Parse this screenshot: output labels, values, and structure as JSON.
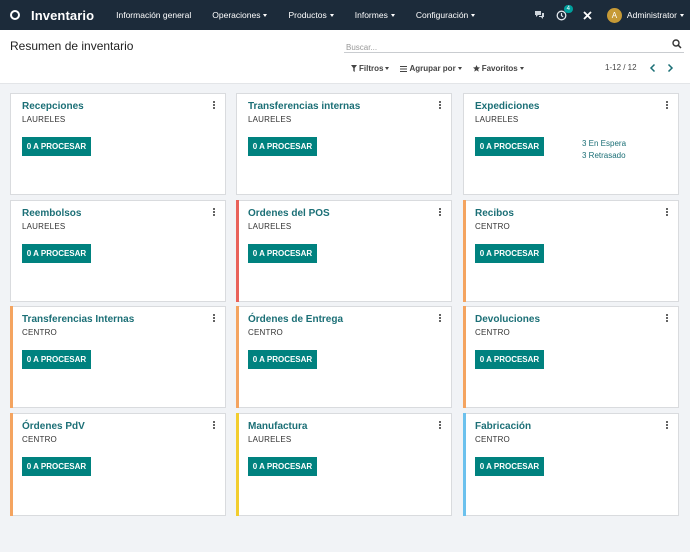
{
  "app": {
    "name": "Inventario"
  },
  "menu": [
    {
      "label": "Información general",
      "caret": false
    },
    {
      "label": "Operaciones",
      "caret": true
    },
    {
      "label": "Productos",
      "caret": true
    },
    {
      "label": "Informes",
      "caret": true
    },
    {
      "label": "Configuración",
      "caret": true
    }
  ],
  "systray": {
    "activity_count": "4",
    "user_initial": "A",
    "user_name": "Administrator"
  },
  "page": {
    "title": "Resumen de inventario"
  },
  "search": {
    "placeholder": "Buscar..."
  },
  "filters": {
    "filters": "Filtros",
    "group_by": "Agrupar por",
    "favorites": "Favoritos"
  },
  "pager": {
    "value": "1-12 / 12"
  },
  "colors": {
    "navbar": "#1c2b3a",
    "accent": "#00827f",
    "title": "#1b6f76",
    "red": "#e9625a",
    "orange": "#f4a460",
    "yellow": "#f2cd2e",
    "blue": "#6cc1ed"
  },
  "cards": [
    {
      "title": "Recepciones",
      "warehouse": "LAURELES",
      "button": "0 A PROCESAR",
      "color": ""
    },
    {
      "title": "Transferencias internas",
      "warehouse": "LAURELES",
      "button": "0 A PROCESAR",
      "color": ""
    },
    {
      "title": "Expediciones",
      "warehouse": "LAURELES",
      "button": "0 A PROCESAR",
      "color": "",
      "waiting": "3 En Espera",
      "late": "3 Retrasado"
    },
    {
      "title": "Reembolsos",
      "warehouse": "LAURELES",
      "button": "0 A PROCESAR",
      "color": ""
    },
    {
      "title": "Ordenes del POS",
      "warehouse": "LAURELES",
      "button": "0 A PROCESAR",
      "color": "#e9625a"
    },
    {
      "title": "Recibos",
      "warehouse": "CENTRO",
      "button": "0 A PROCESAR",
      "color": "#f4a460"
    },
    {
      "title": "Transferencias Internas",
      "warehouse": "CENTRO",
      "button": "0 A PROCESAR",
      "color": "#f4a460"
    },
    {
      "title": "Órdenes de Entrega",
      "warehouse": "CENTRO",
      "button": "0 A PROCESAR",
      "color": "#f4a460"
    },
    {
      "title": "Devoluciones",
      "warehouse": "CENTRO",
      "button": "0 A PROCESAR",
      "color": "#f4a460"
    },
    {
      "title": "Órdenes PdV",
      "warehouse": "CENTRO",
      "button": "0 A PROCESAR",
      "color": "#f4a460"
    },
    {
      "title": "Manufactura",
      "warehouse": "LAURELES",
      "button": "0 A PROCESAR",
      "color": "#f2cd2e"
    },
    {
      "title": "Fabricación",
      "warehouse": "CENTRO",
      "button": "0 A PROCESAR",
      "color": "#6cc1ed"
    }
  ]
}
